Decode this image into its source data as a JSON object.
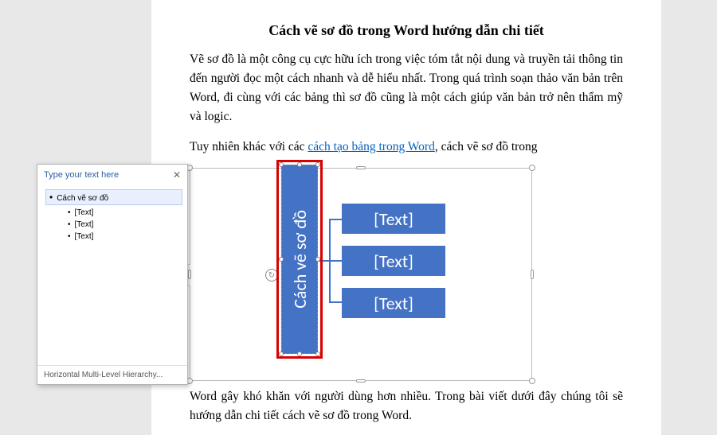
{
  "doc": {
    "title": "Cách vẽ sơ đồ trong Word hướng dẫn chi tiết",
    "para1": "Vẽ sơ đồ là một công cụ cực hữu ích trong việc tóm tắt nội dung và truyền tải thông tin đến người đọc một cách nhanh và dễ hiểu nhất. Trong quá trình soạn thảo văn bản trên Word, đi cùng với các bảng thì sơ đồ cũng là một cách giúp văn bản trở nên thẩm mỹ và logic.",
    "para2_pre": "Tuy nhiên khác với các ",
    "para2_link": "cách tạo bảng trong Word",
    "para2_post": ", cách vẽ sơ đồ trong",
    "para3": "Word gây khó khăn với người dùng hơn nhiều. Trong bài viết dưới đây chúng tôi sẽ hướng dẫn chi tiết cách vẽ sơ đồ trong Word."
  },
  "smartart": {
    "main": "Cách vẽ sơ đồ",
    "children": [
      "[Text]",
      "[Text]",
      "[Text]"
    ]
  },
  "textpane": {
    "header": "Type your text here",
    "items": {
      "root": "Cách vẽ sơ đồ",
      "children": [
        "[Text]",
        "[Text]",
        "[Text]"
      ]
    },
    "footer": "Horizontal Multi-Level Hierarchy..."
  }
}
